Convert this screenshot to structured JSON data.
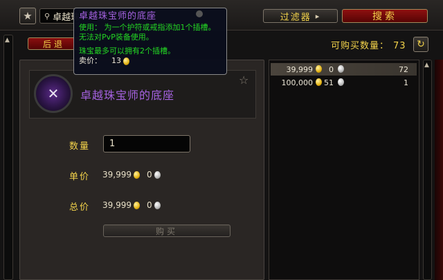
{
  "header": {
    "search_value": "卓越珠",
    "filter_label": "过滤器",
    "filter_arrow": "▸",
    "search_label": "搜索",
    "back_label": "后退",
    "available_label": "可购买数量：",
    "available_count": "73"
  },
  "tooltip": {
    "title": "卓越珠宝师的底座",
    "use_text": "使用：  为一个护符或戒指添加1个插槽。无法对PvP装备使用。",
    "note": "珠宝最多可以拥有2个插槽。",
    "sell_label": "卖价：",
    "sell_value": "13"
  },
  "item": {
    "name": "卓越珠宝师的底座",
    "icon": "jewelcrafter-socket-icon"
  },
  "purchase": {
    "quantity_label": "数量",
    "quantity_value": "1",
    "unit_price_label": "单价",
    "unit_gold": "39,999",
    "unit_silver": "0",
    "total_price_label": "总价",
    "total_gold": "39,999",
    "total_silver": "0",
    "buy_label": "购买"
  },
  "listings": [
    {
      "gold": "39,999",
      "silver": "0",
      "available": "72",
      "selected": true
    },
    {
      "gold": "100,000",
      "silver": "51",
      "available": "1",
      "selected": false
    }
  ],
  "colors": {
    "accent_gold": "#f2d24a",
    "epic_purple": "#a562e0",
    "use_green": "#23d623",
    "red_button": "#8e1010"
  }
}
